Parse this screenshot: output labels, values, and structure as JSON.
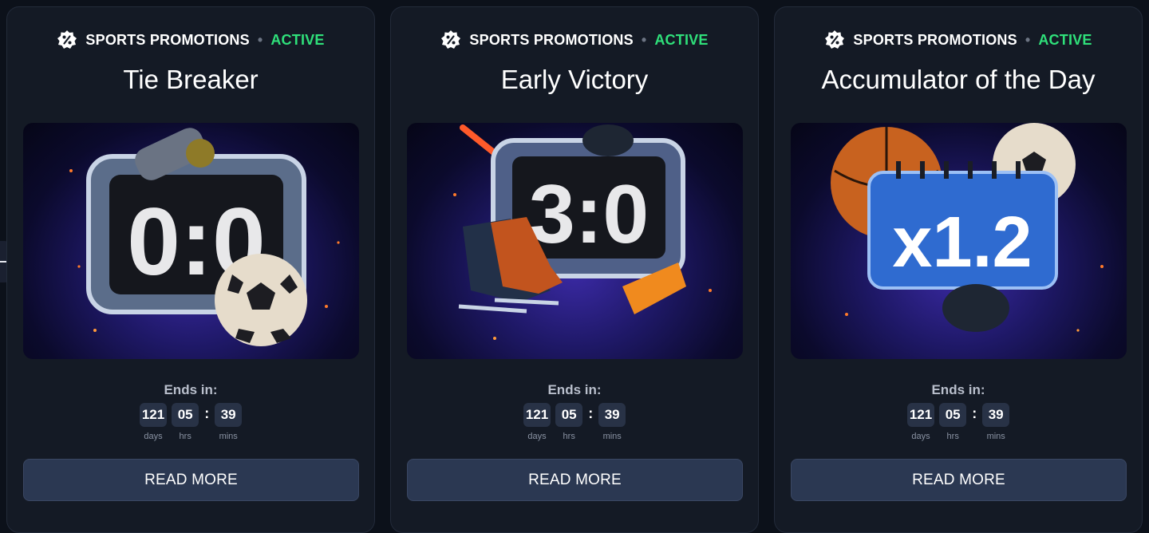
{
  "cards": [
    {
      "category": "SPORTS PROMOTIONS",
      "status": "ACTIVE",
      "title": "Tie Breaker",
      "art_text": "0:0",
      "ends_label": "Ends in:",
      "timer": {
        "days": "121",
        "hrs": "05",
        "mins": "39",
        "days_label": "days",
        "hrs_label": "hrs",
        "mins_label": "mins"
      },
      "button": "READ MORE"
    },
    {
      "category": "SPORTS PROMOTIONS",
      "status": "ACTIVE",
      "title": "Early Victory",
      "art_text": "3:0",
      "ends_label": "Ends in:",
      "timer": {
        "days": "121",
        "hrs": "05",
        "mins": "39",
        "days_label": "days",
        "hrs_label": "hrs",
        "mins_label": "mins"
      },
      "button": "READ MORE"
    },
    {
      "category": "SPORTS PROMOTIONS",
      "status": "ACTIVE",
      "title": "Accumulator of the Day",
      "art_text": "x1.2",
      "ends_label": "Ends in:",
      "timer": {
        "days": "121",
        "hrs": "05",
        "mins": "39",
        "days_label": "days",
        "hrs_label": "hrs",
        "mins_label": "mins"
      },
      "button": "READ MORE"
    }
  ],
  "colors": {
    "background": "#0c111a",
    "card": "#141a25",
    "status_active": "#2fe07a",
    "button": "#2b3852",
    "timer_box": "#283246"
  },
  "icons": {
    "category": "percent-badge-icon",
    "edge_tab": "minus-icon"
  }
}
